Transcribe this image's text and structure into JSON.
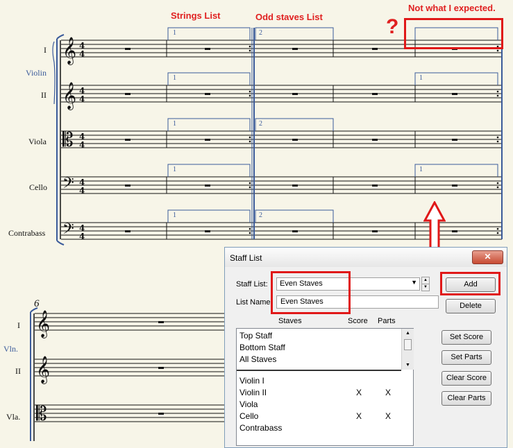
{
  "annotations": {
    "strings_list": "Strings List",
    "odd_staves_list": "Odd staves List",
    "not_expected": "Not what I expected.",
    "question": "?"
  },
  "score": {
    "instruments_top": {
      "violin_i": "I",
      "violin_group": "Violin",
      "violin_ii": "II",
      "viola": "Viola",
      "cello": "Cello",
      "contrabass": "Contrabass"
    },
    "ending_labels": [
      "1",
      "2"
    ],
    "measure_number": "6",
    "instruments_bottom": {
      "violin_i": "I",
      "violin_group": "Vln.",
      "violin_ii": "II",
      "viola": "Vla."
    },
    "time_signature": "4/4"
  },
  "dialog": {
    "title": "Staff List",
    "close_label": "✕",
    "staff_list_label": "Staff List:",
    "staff_list_value": "Even Staves",
    "list_name_label": "List Name:",
    "list_name_value": "Even Staves",
    "add_label": "Add",
    "delete_label": "Delete",
    "columns": {
      "staves": "Staves",
      "score": "Score",
      "parts": "Parts"
    },
    "top_items": [
      "Top Staff",
      "Bottom Staff",
      "All Staves"
    ],
    "staff_rows": [
      {
        "name": "Violin I",
        "score": "",
        "parts": ""
      },
      {
        "name": "Violin II",
        "score": "X",
        "parts": "X"
      },
      {
        "name": "Viola",
        "score": "",
        "parts": ""
      },
      {
        "name": "Cello",
        "score": "X",
        "parts": "X"
      },
      {
        "name": "Contrabass",
        "score": "",
        "parts": ""
      }
    ],
    "set_score_label": "Set Score",
    "set_parts_label": "Set Parts",
    "clear_score_label": "Clear Score",
    "clear_parts_label": "Clear Parts"
  },
  "colors": {
    "annotation_red": "#e02020",
    "ending_blue": "#3a5a9a",
    "paper": "#f7f5e8"
  }
}
